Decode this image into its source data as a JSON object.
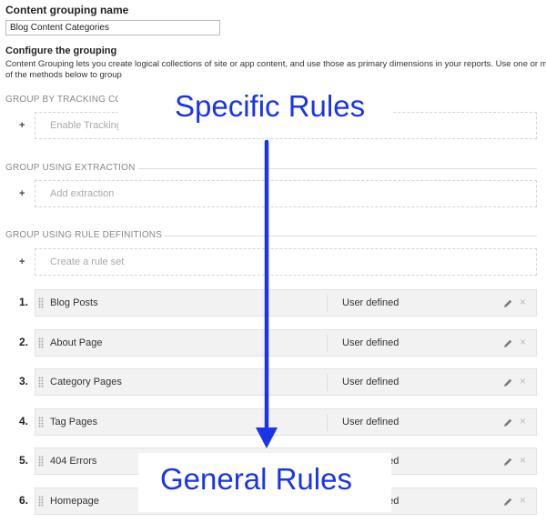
{
  "content_grouping": {
    "name_label": "Content grouping name",
    "name_value": "Blog Content Categories"
  },
  "configure": {
    "title": "Configure the grouping",
    "desc_line1": "Content Grouping lets you create logical collections of site or app content, and use those as primary dimensions in your reports. Use one or more",
    "desc_line2": "of the methods below to group"
  },
  "sections": {
    "tracking": {
      "header": "GROUP BY TRACKING CO",
      "action": "Enable Tracking"
    },
    "extraction": {
      "header": "GROUP USING EXTRACTION",
      "action": "Add extraction"
    },
    "rules": {
      "header": "GROUP USING RULE DEFINITIONS",
      "action": "Create a rule set"
    }
  },
  "plus_symbol": "+",
  "rules": [
    {
      "num": "1.",
      "name": "Blog Posts",
      "type": "User defined"
    },
    {
      "num": "2.",
      "name": "About Page",
      "type": "User defined"
    },
    {
      "num": "3.",
      "name": "Category Pages",
      "type": "User defined"
    },
    {
      "num": "4.",
      "name": "Tag Pages",
      "type": "User defined"
    },
    {
      "num": "5.",
      "name": "404 Errors",
      "type": "User defined"
    },
    {
      "num": "6.",
      "name": "Homepage",
      "type": "User defined"
    }
  ],
  "row_icons": {
    "edit": "pencil-icon",
    "delete": "close-icon"
  },
  "close_symbol": "×",
  "annotations": {
    "top": "Specific Rules",
    "bottom": "General Rules",
    "color": "#1a35e8"
  }
}
